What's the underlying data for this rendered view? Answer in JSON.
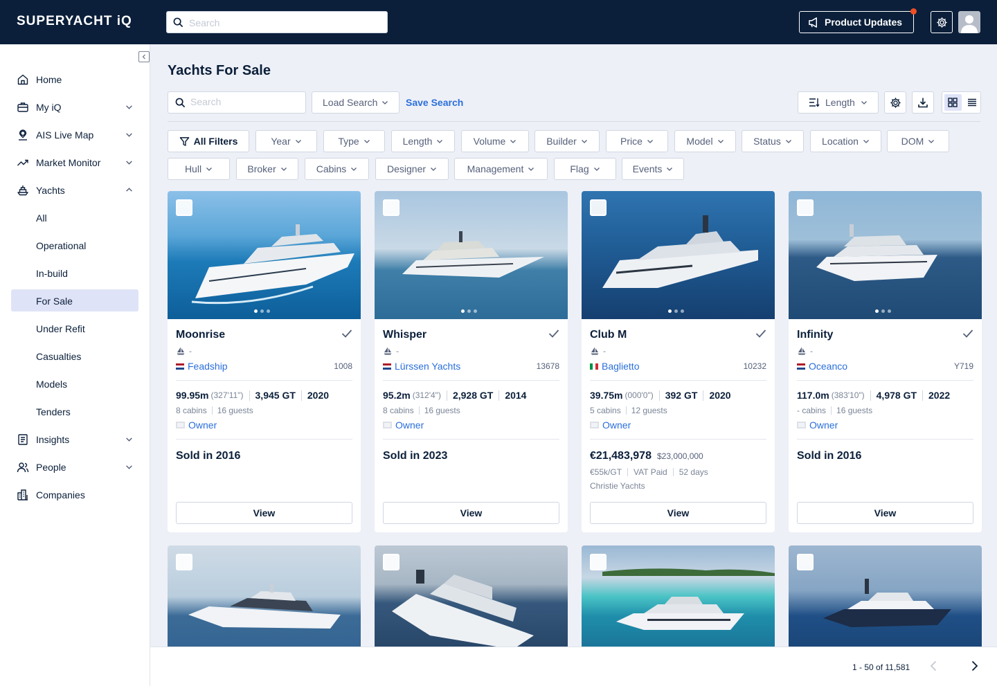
{
  "app": {
    "brand": "SUPERYACHT iQ"
  },
  "topbar": {
    "search_placeholder": "Search",
    "product_updates_label": "Product Updates"
  },
  "sidebar": {
    "items": [
      {
        "label": "Home",
        "icon": "home-icon"
      },
      {
        "label": "My iQ",
        "icon": "briefcase-icon",
        "expandable": true
      },
      {
        "label": "AIS Live Map",
        "icon": "map-pin-icon",
        "expandable": true
      },
      {
        "label": "Market Monitor",
        "icon": "trend-icon",
        "expandable": true
      },
      {
        "label": "Yachts",
        "icon": "yacht-icon",
        "expandable": true,
        "expanded": true
      }
    ],
    "sub_items": [
      {
        "label": "All"
      },
      {
        "label": "Operational"
      },
      {
        "label": "In-build"
      },
      {
        "label": "For Sale",
        "active": true
      },
      {
        "label": "Under Refit"
      },
      {
        "label": "Casualties"
      },
      {
        "label": "Models"
      },
      {
        "label": "Tenders"
      }
    ],
    "bottom_items": [
      {
        "label": "Insights",
        "icon": "newspaper-icon",
        "expandable": true
      },
      {
        "label": "People",
        "icon": "people-icon",
        "expandable": true
      },
      {
        "label": "Companies",
        "icon": "building-icon"
      }
    ]
  },
  "main": {
    "title": "Yachts For Sale",
    "search_placeholder": "Search",
    "load_search_label": "Load Search",
    "save_search_label": "Save Search",
    "sort_label": "Length",
    "filters_row1": [
      "All Filters",
      "Year",
      "Type",
      "Length",
      "Volume",
      "Builder",
      "Price",
      "Model",
      "Status",
      "Location",
      "DOM"
    ],
    "filters_row2": [
      "Hull",
      "Broker",
      "Cabins",
      "Designer",
      "Management",
      "Flag",
      "Events"
    ]
  },
  "cards": [
    {
      "name": "Moonrise",
      "type": "-",
      "builder": "Feadship",
      "builder_flag": "nl",
      "ref": "1008",
      "length": "99.95m",
      "length_ft": "(327'11\")",
      "gt": "3,945 GT",
      "year": "2020",
      "cabins": "8 cabins",
      "guests": "16 guests",
      "owner": "Owner",
      "status": "Sold in 2016",
      "view_label": "View"
    },
    {
      "name": "Whisper",
      "type": "-",
      "builder": "Lürssen Yachts",
      "builder_flag": "nl",
      "ref": "13678",
      "length": "95.2m",
      "length_ft": "(312'4\")",
      "gt": "2,928 GT",
      "year": "2014",
      "cabins": "8 cabins",
      "guests": "16 guests",
      "owner": "Owner",
      "status": "Sold in 2023",
      "view_label": "View"
    },
    {
      "name": "Club M",
      "type": "-",
      "builder": "Baglietto",
      "builder_flag": "it",
      "ref": "10232",
      "length": "39.75m",
      "length_ft": "(000'0\")",
      "gt": "392 GT",
      "year": "2020",
      "cabins": "5 cabins",
      "guests": "12 guests",
      "owner": "Owner",
      "price": "€21,483,978",
      "original_price": "$23,000,000",
      "per_gt": "€55k/GT",
      "vat": "VAT Paid",
      "dom": "52 days",
      "broker": "Christie Yachts",
      "view_label": "View"
    },
    {
      "name": "Infinity",
      "type": "-",
      "builder": "Oceanco",
      "builder_flag": "nl",
      "ref": "Y719",
      "length": "117.0m",
      "length_ft": "(383'10\")",
      "gt": "4,978 GT",
      "year": "2022",
      "cabins": "- cabins",
      "guests": "16 guests",
      "owner": "Owner",
      "status": "Sold in 2016",
      "view_label": "View"
    }
  ],
  "pager": {
    "range_label": "1 - 50 of 11,581"
  },
  "colors": {
    "navy": "#0b1f3a",
    "accent_blue": "#2a6fdb",
    "active_nav": "#dfe3f7",
    "notification": "#f04e23"
  }
}
